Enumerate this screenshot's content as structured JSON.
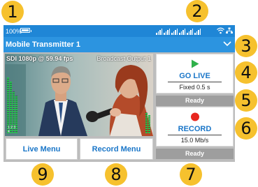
{
  "callouts": [
    "1",
    "2",
    "3",
    "4",
    "5",
    "6",
    "7",
    "8",
    "9"
  ],
  "status_bar": {
    "battery_percent": "100%",
    "battery_icon": "battery-full-icon",
    "signal_icon": "cellular-signal-icon",
    "signal_count": 6,
    "wifi_icon": "wifi-icon",
    "network_icon": "ethernet-icon"
  },
  "header": {
    "title": "Mobile Transmitter 1",
    "chevron_icon": "chevron-down-icon"
  },
  "preview": {
    "source": "SDI 1080p @ 59.94 fps",
    "output": "Broadcast Output 1",
    "meter_numbers": "1 2 3 4"
  },
  "go_live": {
    "icon": "play-icon",
    "label": "GO LIVE",
    "sub": "Fixed 0.5 s",
    "state": "Ready"
  },
  "record": {
    "icon": "record-icon",
    "label": "RECORD",
    "sub": "15.0 Mb/s",
    "state": "Ready"
  },
  "menus": {
    "live": "Live Menu",
    "record": "Record Menu"
  },
  "colors": {
    "header_blue": "#2c94e0",
    "status_blue": "#1f86d6",
    "link_blue": "#1a76c8",
    "play_green": "#2fb14a",
    "record_red": "#e8271f",
    "callout_yellow": "#f6c12e"
  }
}
